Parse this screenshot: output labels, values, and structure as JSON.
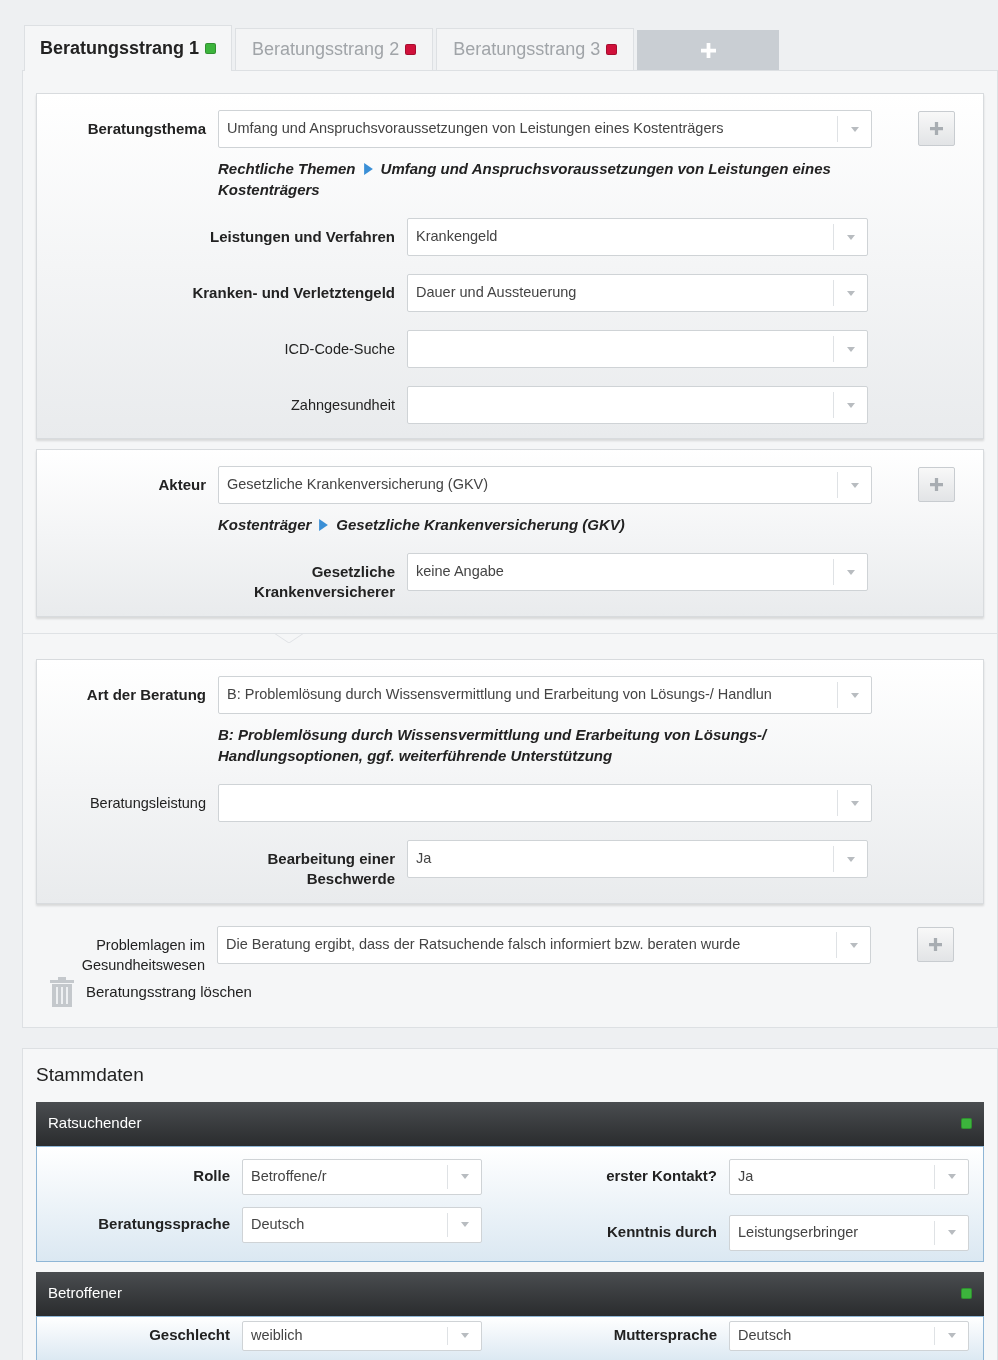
{
  "tabs": [
    {
      "label": "Beratungsstrang 1",
      "selected": true,
      "color": "#3cb43c"
    },
    {
      "label": "Beratungsstrang 2",
      "selected": false,
      "color": "#d0103a"
    },
    {
      "label": "Beratungsstrang 3",
      "selected": false,
      "color": "#d0103a"
    }
  ],
  "add_tab_button": true,
  "panels": [
    {
      "kind": "panel",
      "fields": [
        {
          "kind": "wide",
          "label": "Beratungsthema",
          "required": true,
          "value": "Umfang und Anspruchsvoraussetzungen von Leistungen eines Kostenträgers",
          "add_button": true,
          "breadcrumb": [
            "Rechtliche Themen",
            "Umfang und Anspruchsvoraussetzungen von Leistungen eines Kostenträgers"
          ]
        },
        {
          "kind": "narrow",
          "label": "Leistungen und Verfahren",
          "required": true,
          "value": "Krankengeld",
          "add_button": false
        },
        {
          "kind": "narrow",
          "label": "Kranken- und Verletztengeld",
          "required": true,
          "value": "Dauer und Aussteuerung",
          "add_button": false
        },
        {
          "kind": "narrow",
          "label": "ICD-Code-Suche",
          "required": false,
          "add_button": false
        },
        {
          "kind": "narrow",
          "label": "Zahngesundheit",
          "required": false,
          "add_button": false
        }
      ]
    },
    {
      "kind": "panel",
      "fields": [
        {
          "kind": "wide",
          "label": "Akteur",
          "required": true,
          "value": "Gesetzliche Krankenversicherung (GKV)",
          "add_button": true,
          "breadcrumb": [
            "Kostenträger",
            "Gesetzliche Krankenversicherung (GKV)"
          ]
        },
        {
          "kind": "narrow",
          "label": "Gesetzliche\nKrankenversicherer",
          "required": true,
          "value": "keine Angabe",
          "add_button": false
        }
      ]
    },
    {
      "kind": "divider"
    },
    {
      "kind": "panel",
      "fields": [
        {
          "kind": "wide",
          "label": "Art der Beratung",
          "required": true,
          "value": "B: Problemlösung durch Wissensvermittlung und Erarbeitung von Lösungs-/ Handlun",
          "add_button": false,
          "breadcrumb": [
            "B: Problemlösung durch Wissensvermittlung und Erarbeitung von Lösungs-/ Handlungsoptionen, ggf. weiterführende Unterstützung"
          ]
        },
        {
          "kind": "wide",
          "label": "Beratungsleistung",
          "required": false,
          "add_button": false
        },
        {
          "kind": "narrow",
          "label": "Bearbeitung einer\nBeschwerde",
          "required": true,
          "value": "Ja",
          "add_button": false
        }
      ]
    },
    {
      "kind": "plain",
      "fields": [
        {
          "kind": "wide",
          "label": "Problemlagen im\nGesundheitswesen",
          "required": false,
          "value": "Die Beratung ergibt, dass der Ratsuchende falsch informiert bzw. beraten wurde",
          "add_button": true
        }
      ]
    }
  ],
  "delete_link": "Beratungsstrang löschen",
  "stammdaten": {
    "title": "Stammdaten",
    "sections": [
      {
        "title": "Ratsuchender",
        "color": "#3cb43c",
        "columns": [
          [
            {
              "label": "Rolle",
              "value": "Betroffene/r"
            },
            {
              "label": "Beratungssprache",
              "value": "Deutsch"
            }
          ],
          [
            {
              "label": "erster Kontakt?",
              "value": "Ja"
            },
            {
              "label": "Kenntnis durch",
              "value": "Leistungserbringer"
            }
          ]
        ]
      },
      {
        "title": "Betroffener",
        "color": "#3cb43c",
        "columns": [
          [
            {
              "label": "Geschlecht",
              "value": "weiblich"
            }
          ],
          [
            {
              "label": "Muttersprache",
              "value": "Deutsch"
            }
          ]
        ]
      }
    ]
  }
}
